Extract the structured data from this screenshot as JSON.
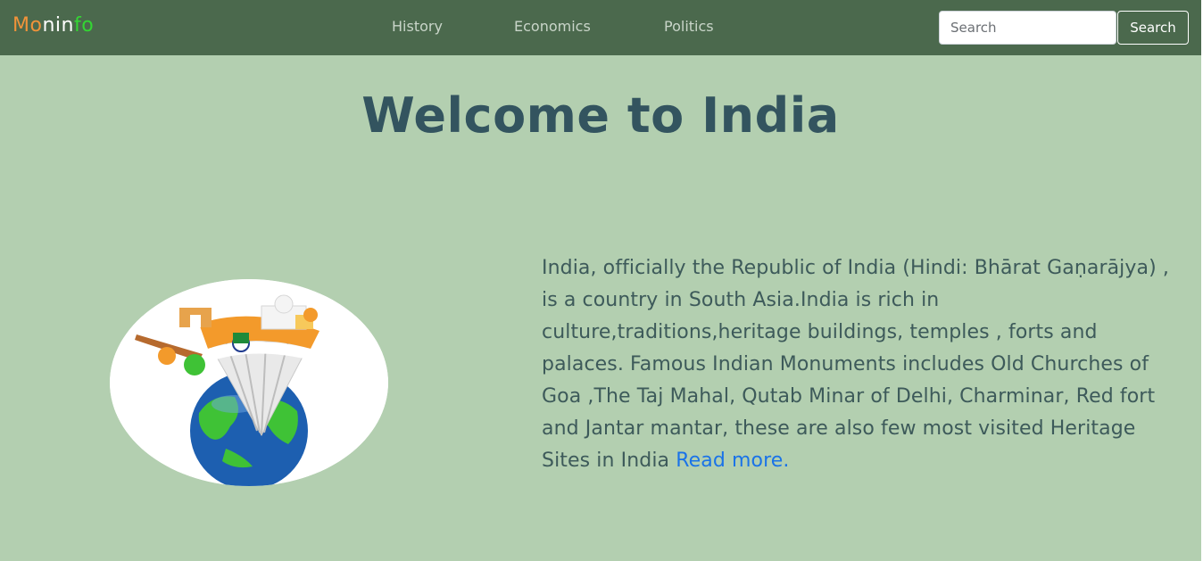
{
  "navbar": {
    "brand": {
      "part1": "Mo",
      "part2": "nin",
      "part3": "fo"
    },
    "links": [
      {
        "label": "History"
      },
      {
        "label": "Economics"
      },
      {
        "label": "Politics"
      }
    ],
    "search": {
      "placeholder": "Search",
      "value": "",
      "button_label": "Search"
    }
  },
  "hero": {
    "title": "Welcome to India",
    "description": "India, officially the Republic of India (Hindi: Bhārat Gaṇarājya) , is a country in South Asia.India is rich in culture,traditions,heritage buildings, temples , forts and palaces. Famous Indian Monuments includes Old Churches of Goa ,The Taj Mahal, Qutab Minar of Delhi, Charminar, Red fort and Jantar mantar, these are also few most visited Heritage Sites in India ",
    "read_more": "Read more."
  },
  "colors": {
    "navbar_bg": "#4b694d",
    "page_bg": "#b3cfb0",
    "title": "#33545f",
    "text": "#3d5a5a",
    "link": "#1a73e8",
    "brand_orange": "#f0933a",
    "brand_green": "#33d633"
  }
}
